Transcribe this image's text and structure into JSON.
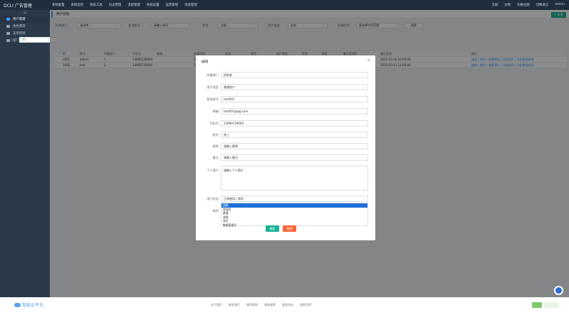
{
  "header": {
    "logo": "DCLI 广告管理",
    "nav": [
      "系统配置",
      "系统监控",
      "系统工具",
      "日志管理",
      "流程管理",
      "系统设置",
      "运营管理",
      "消息管理"
    ],
    "right": [
      "全屏",
      "文档",
      "切换主题",
      "切换语言",
      "admin"
    ]
  },
  "sidebar": {
    "collapse": "☰",
    "items": [
      {
        "label": "用户管理"
      },
      {
        "label": "角色管理"
      },
      {
        "label": "菜单管理"
      },
      {
        "label": "部门管理"
      }
    ]
  },
  "tabbar": {
    "tab": "用户管理",
    "add_label": "+ 新增"
  },
  "filters": {
    "f1_label": "所属部门",
    "f1_value": "请选择",
    "f2_label": "登录账号",
    "f2_value": "请输入账号",
    "f3_label": "状态",
    "f3_value": "全部",
    "f4_label": "用户类型",
    "f4_value": "全部",
    "f5_label": "注册时间",
    "f5_value": "请选择时间范围",
    "search_label": "搜索",
    "row2_label": "显示",
    "row2_value": "10"
  },
  "table": {
    "headers": [
      "ID",
      "账号",
      "所属部门",
      "手机号",
      "邮箱",
      "创建时间",
      "状态",
      "角色",
      "用户类型",
      "性别",
      "地区",
      "最后登录IP",
      "最后登录",
      "操作"
    ],
    "rows": [
      [
        "1001",
        "admin",
        "1",
        "13800138000",
        "",
        "2023-01-01 00:00:00",
        "正常",
        "超级管理员",
        "系统",
        "男",
        "",
        "192.168.1.1",
        "2023-10-10 10:00:00",
        "编辑 | 删除 | 重置密码 | 分配角色 | 分配数据权限"
      ],
      [
        "1002",
        "test",
        "2",
        "13900139000",
        "",
        "2023-02-01 00:00:00",
        "正常",
        "普通用户",
        "普通",
        "女",
        "",
        "192.168.1.2",
        "2023-10-11 11:00:00",
        "编辑 | 删除 | 重置密码 | 分配角色 | 分配数据权限"
      ]
    ]
  },
  "dialog": {
    "title": "编辑",
    "close": "×",
    "fields": [
      {
        "label": "所属部门",
        "value": "研发部",
        "select": true
      },
      {
        "label": "用户类型",
        "value": "普通用户",
        "select": true
      },
      {
        "label": "登录账号",
        "value": "test001",
        "select": false
      },
      {
        "label": "邮箱",
        "value": "test001@qq.com",
        "select": false
      },
      {
        "label": "手机号",
        "value": "13900139000",
        "select": false
      },
      {
        "label": "姓名",
        "value": "张三",
        "select": false
      },
      {
        "label": "昵称",
        "value": "请输入昵称",
        "select": false
      },
      {
        "label": "备注",
        "value": "请输入备注",
        "select": false
      }
    ],
    "remark_label": "个人简介",
    "remark_value": "请输入个人简介",
    "status_label": "用户状态",
    "status_value": "正常使用 | 禁用",
    "role_label": "角色",
    "dropdown": [
      "超级",
      "管理员",
      "普通",
      "游客",
      "测试",
      "数据管理员"
    ],
    "ok": "确定",
    "cancel": "取消"
  },
  "footer": {
    "logo": "智能云平台",
    "links": [
      "关于我们",
      "联系我们",
      "使用帮助",
      "隐私政策",
      "服务协议",
      "版权声明"
    ]
  },
  "colors": {
    "primary": "#409eff",
    "success": "#1ab394",
    "danger": "#f8663a",
    "dark": "#1f2d3d"
  }
}
